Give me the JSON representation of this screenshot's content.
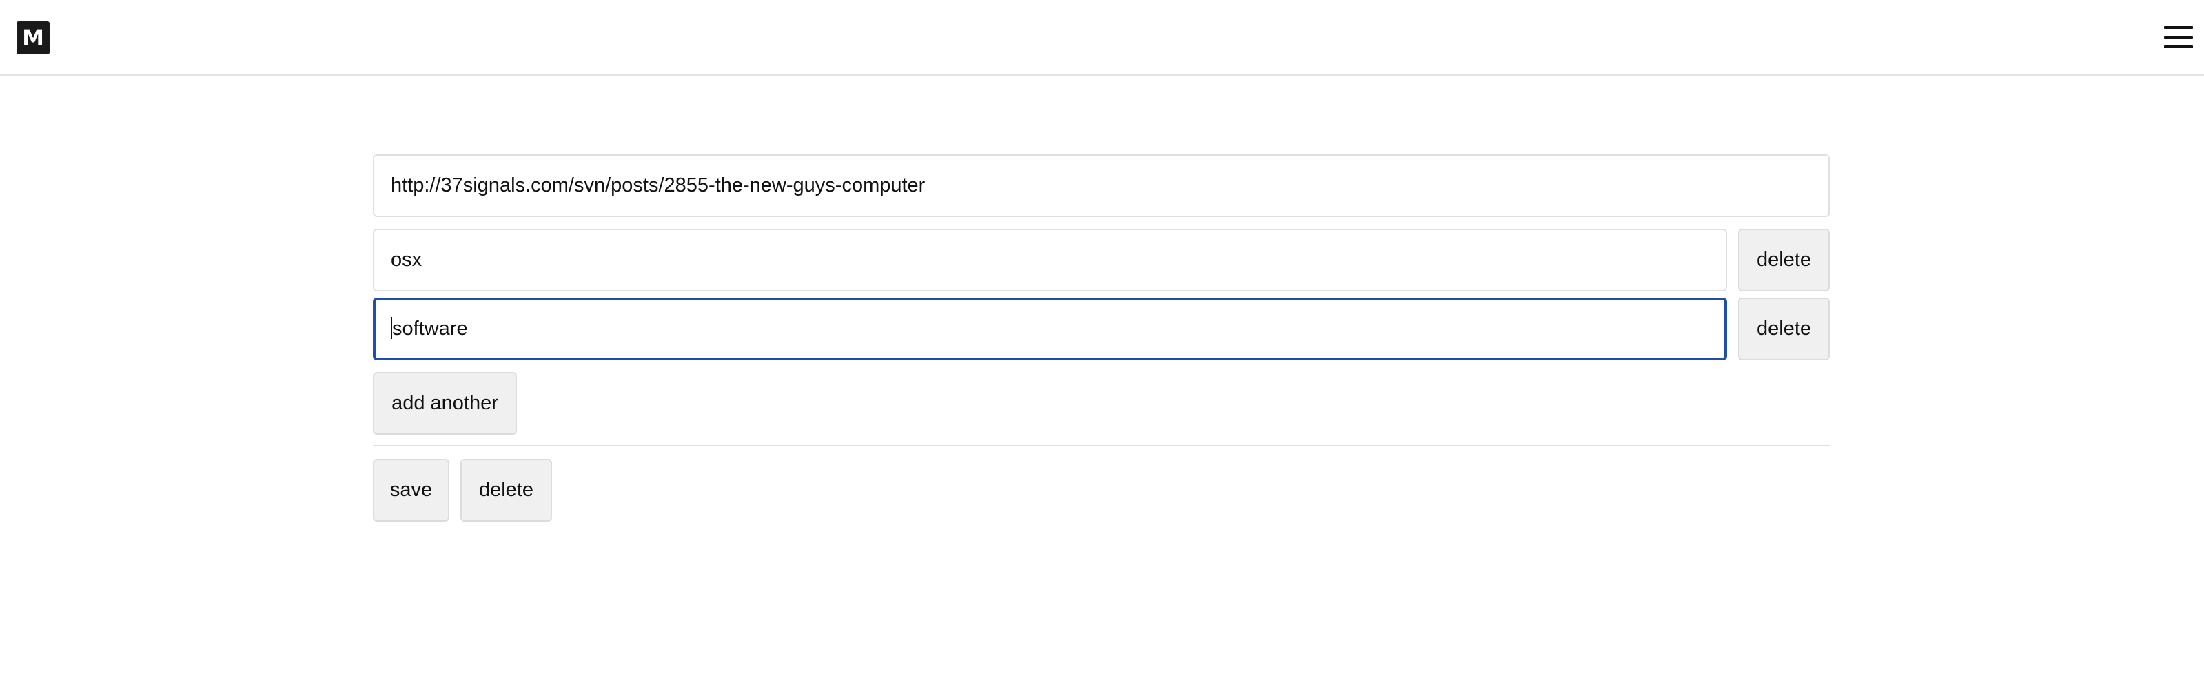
{
  "header": {
    "logo_text": "M",
    "menu_icon": "hamburger-menu-icon"
  },
  "form": {
    "url": {
      "value": "http://37signals.com/svn/posts/2855-the-new-guys-computer"
    },
    "tags": [
      {
        "value": "osx",
        "delete_label": "delete",
        "focused": false
      },
      {
        "value": "software",
        "delete_label": "delete",
        "focused": true
      }
    ],
    "add_another_label": "add another",
    "save_label": "save",
    "delete_label": "delete"
  },
  "colors": {
    "focus_border": "#1f4fa8",
    "button_bg": "#f0f0f0",
    "logo_bg": "#1a1a1a"
  }
}
